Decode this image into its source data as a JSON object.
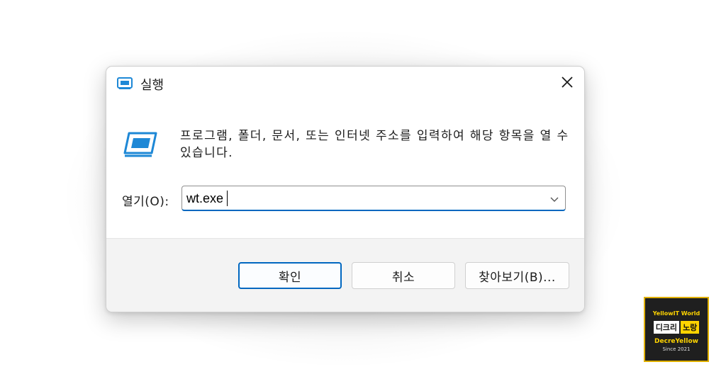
{
  "dialog": {
    "title": "실행",
    "description": "프로그램, 폴더, 문서, 또는 인터넷 주소를 입력하여 해당 항목을 열 수 있습니다.",
    "open_label": "열기(O):",
    "open_value": "wt.exe",
    "buttons": {
      "ok": "확인",
      "cancel": "취소",
      "browse": "찾아보기(B)..."
    }
  },
  "icons": {
    "title": "run-icon",
    "large": "run-icon",
    "close": "close-icon",
    "dropdown": "chevron-down-icon"
  },
  "colors": {
    "accent": "#0067c0",
    "icon": "#1e88d6",
    "footer": "#f3f3f3"
  },
  "watermark": {
    "top": "YellowIT World",
    "left_badge": "디크리",
    "right_badge": "노랑",
    "name": "DecreYellow",
    "since": "Since 2021"
  }
}
